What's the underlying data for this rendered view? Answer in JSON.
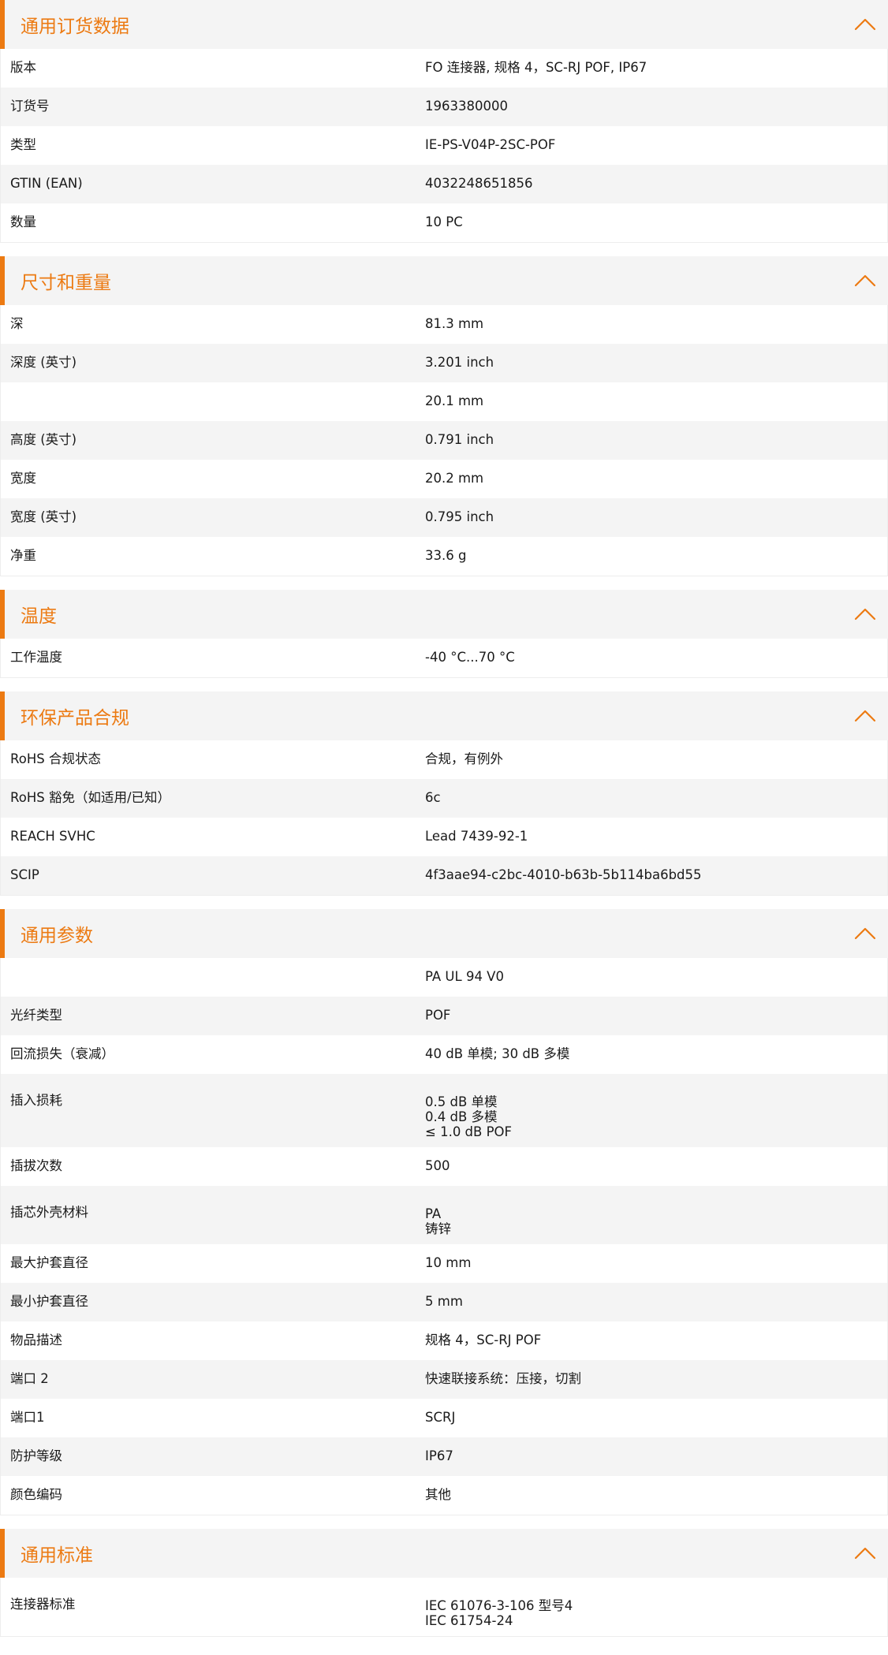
{
  "colors": {
    "accent": "#ec7a12",
    "header_bg": "#f4f4f4",
    "row_alt": "#f4f4f4"
  },
  "icons": {
    "collapse": "chevron-up-icon"
  },
  "sections": [
    {
      "title": "通用订货数据",
      "rows": [
        {
          "label": "版本",
          "value": "FO 连接器, 规格 4，SC-RJ POF, IP67"
        },
        {
          "label": "订货号",
          "value": "1963380000"
        },
        {
          "label": "类型",
          "value": "IE-PS-V04P-2SC-POF"
        },
        {
          "label": "GTIN (EAN)",
          "value": "4032248651856"
        },
        {
          "label": "数量",
          "value": "10  PC"
        }
      ]
    },
    {
      "title": "尺寸和重量",
      "rows": [
        {
          "label": "深",
          "value": "81.3  mm"
        },
        {
          "label": "深度 (英寸)",
          "value": "3.201  inch"
        },
        {
          "label": "",
          "value": "20.1  mm"
        },
        {
          "label": "高度 (英寸)",
          "value": "0.791  inch"
        },
        {
          "label": "宽度",
          "value": "20.2  mm"
        },
        {
          "label": "宽度 (英寸)",
          "value": "0.795  inch"
        },
        {
          "label": "净重",
          "value": "33.6  g"
        }
      ]
    },
    {
      "title": "温度",
      "rows": [
        {
          "label": "工作温度",
          "value": "-40 °C...70 °C"
        }
      ]
    },
    {
      "title": "环保产品合规",
      "rows": [
        {
          "label": "RoHS 合规状态",
          "value": "合规，有例外"
        },
        {
          "label": "RoHS 豁免（如适用/已知）",
          "value": "6c"
        },
        {
          "label": "REACH SVHC",
          "value": "Lead 7439-92-1"
        },
        {
          "label": "SCIP",
          "value": "4f3aae94-c2bc-4010-b63b-5b114ba6bd55"
        }
      ]
    },
    {
      "title": "通用参数",
      "rows": [
        {
          "label": "",
          "value": "PA UL 94 V0"
        },
        {
          "label": "光纤类型",
          "value": "POF"
        },
        {
          "label": "回流损失（衰减）",
          "value": "40 dB 单模; 30 dB 多模"
        },
        {
          "label": "插入损耗",
          "lines": [
            "0.5 dB 单模",
            "0.4 dB 多模",
            "≤ 1.0 dB POF"
          ]
        },
        {
          "label": "插拔次数",
          "value": "500"
        },
        {
          "label": "插芯外壳材料",
          "lines": [
            "PA",
            "铸锌"
          ]
        },
        {
          "label": "最大护套直径",
          "value": "10  mm"
        },
        {
          "label": "最小护套直径",
          "value": "5  mm"
        },
        {
          "label": "物品描述",
          "value": "规格 4，SC-RJ POF"
        },
        {
          "label": "端口 2",
          "value": "快速联接系统：压接，切割"
        },
        {
          "label": "端口1",
          "value": "SCRJ"
        },
        {
          "label": "防护等级",
          "value": "IP67"
        },
        {
          "label": "颜色编码",
          "value": "其他"
        }
      ]
    },
    {
      "title": "通用标准",
      "rows": [
        {
          "label": "连接器标准",
          "lines": [
            "IEC 61076-3-106 型号4",
            "IEC 61754-24"
          ]
        }
      ]
    }
  ]
}
